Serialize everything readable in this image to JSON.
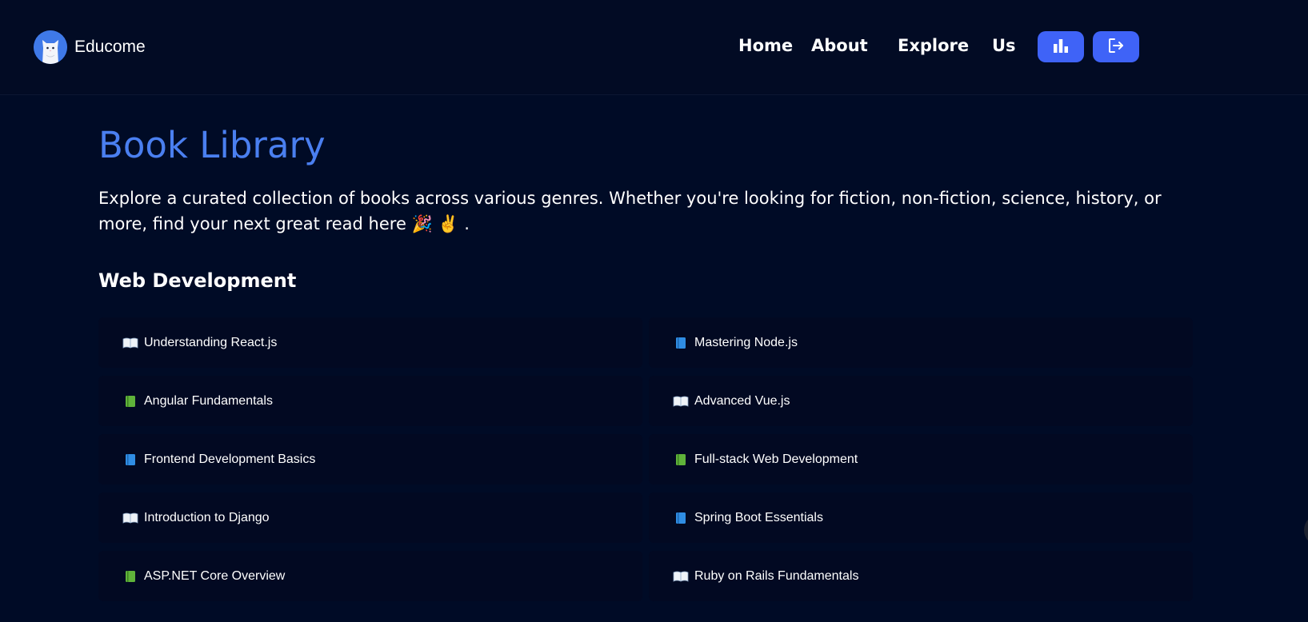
{
  "brand": {
    "name": "Educome",
    "logo_icon": "cat-avatar-icon",
    "logo_color": "#3f79e8"
  },
  "nav": {
    "links": [
      "Home",
      "About",
      "Explore",
      "Us"
    ],
    "stats_button_icon": "bar-chart-icon",
    "logout_button_icon": "logout-icon",
    "button_color": "#3f63f7"
  },
  "main": {
    "title": "Book Library",
    "title_color": "#4a7ff0",
    "intro": "Explore a curated collection of books across various genres. Whether you're looking for fiction, non-fiction, science, history, or more, find your next great read here 🎉 ✌️ .",
    "section": "Web Development"
  },
  "books": [
    {
      "title": "Understanding React.js",
      "icon": "open-book-icon"
    },
    {
      "title": "Mastering Node.js",
      "icon": "blue-book-icon"
    },
    {
      "title": "Angular Fundamentals",
      "icon": "green-book-icon"
    },
    {
      "title": "Advanced Vue.js",
      "icon": "open-book-icon"
    },
    {
      "title": "Frontend Development Basics",
      "icon": "blue-book-icon"
    },
    {
      "title": "Full-stack Web Development",
      "icon": "green-book-icon"
    },
    {
      "title": "Introduction to Django",
      "icon": "open-book-icon"
    },
    {
      "title": "Spring Boot Essentials",
      "icon": "blue-book-icon"
    },
    {
      "title": "ASP.NET Core Overview",
      "icon": "green-book-icon"
    },
    {
      "title": "Ruby on Rails Fundamentals",
      "icon": "open-book-icon"
    }
  ],
  "colors": {
    "background": "#000b26",
    "card": "#020922",
    "book_blue": "#2f8de4",
    "book_green": "#5fb33a"
  }
}
